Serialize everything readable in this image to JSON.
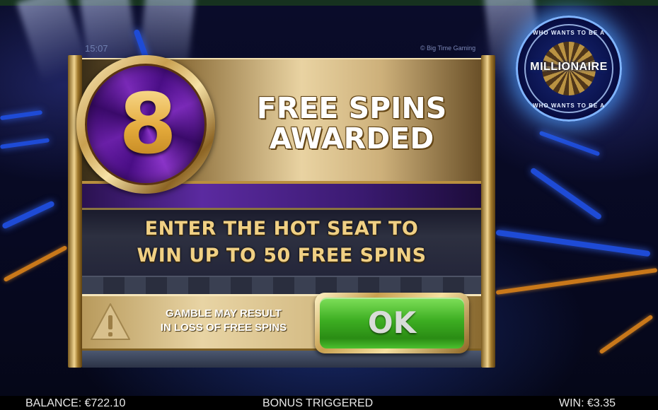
{
  "header": {
    "clock": "15:07",
    "copyright": "© Big Time Gaming"
  },
  "logo": {
    "top_text": "WHO WANTS TO BE A",
    "main_text": "MILLIONAIRE",
    "bottom_text": "WHO WANTS TO BE A"
  },
  "dialog": {
    "spins_count": "8",
    "awarded_line1": "FREE SPINS",
    "awarded_line2": "AWARDED",
    "promo_line1": "ENTER THE HOT SEAT TO",
    "promo_line2": "WIN UP TO 50 FREE SPINS",
    "warning_line1": "GAMBLE MAY RESULT",
    "warning_line2": "IN LOSS OF FREE SPINS",
    "ok_label": "OK"
  },
  "status_bar": {
    "balance": "BALANCE: €722.10",
    "bonus": "BONUS TRIGGERED",
    "win": "WIN: €3.35"
  },
  "colors": {
    "gold": "#e3a93a",
    "purple": "#5b2aa0",
    "ok_green": "#3dae22",
    "rail_blue": "#1e4bd6"
  },
  "icons": {
    "warning": "warning-triangle-icon",
    "logo": "millionaire-logo"
  }
}
